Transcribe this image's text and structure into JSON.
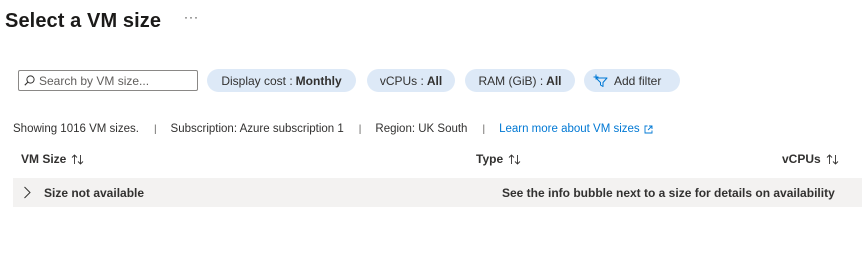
{
  "page": {
    "title": "Select a VM size",
    "more_label": "···"
  },
  "toolbar": {
    "search": {
      "placeholder": "Search by VM size...",
      "value": "",
      "icon": "search-icon"
    },
    "display_cost": {
      "label": "Display cost :",
      "value": "Monthly"
    },
    "vcpus": {
      "label": "vCPUs :",
      "value": "All"
    },
    "ram": {
      "label": "RAM (GiB) :",
      "value": "All"
    },
    "add_filter": {
      "label": "Add filter",
      "icon": "add-filter-icon"
    }
  },
  "info": {
    "showing": "Showing 1016 VM sizes.",
    "subscription": "Subscription: Azure subscription 1",
    "region": "Region: UK South",
    "learn_more": "Learn more about VM sizes",
    "separator": "|"
  },
  "table": {
    "columns": [
      {
        "label": "VM Size",
        "sort_icon": "sort-icon"
      },
      {
        "label": "Type",
        "sort_icon": "sort-icon"
      },
      {
        "label": "vCPUs",
        "sort_icon": "sort-icon"
      }
    ],
    "groups": [
      {
        "label": "Size not available",
        "note": "See the info bubble next to a size for details on availability",
        "expanded": false
      }
    ]
  },
  "colors": {
    "accent": "#0078d4",
    "pill_bg": "#dde9f7",
    "group_bg": "#f3f2f1",
    "text": "#323130"
  }
}
